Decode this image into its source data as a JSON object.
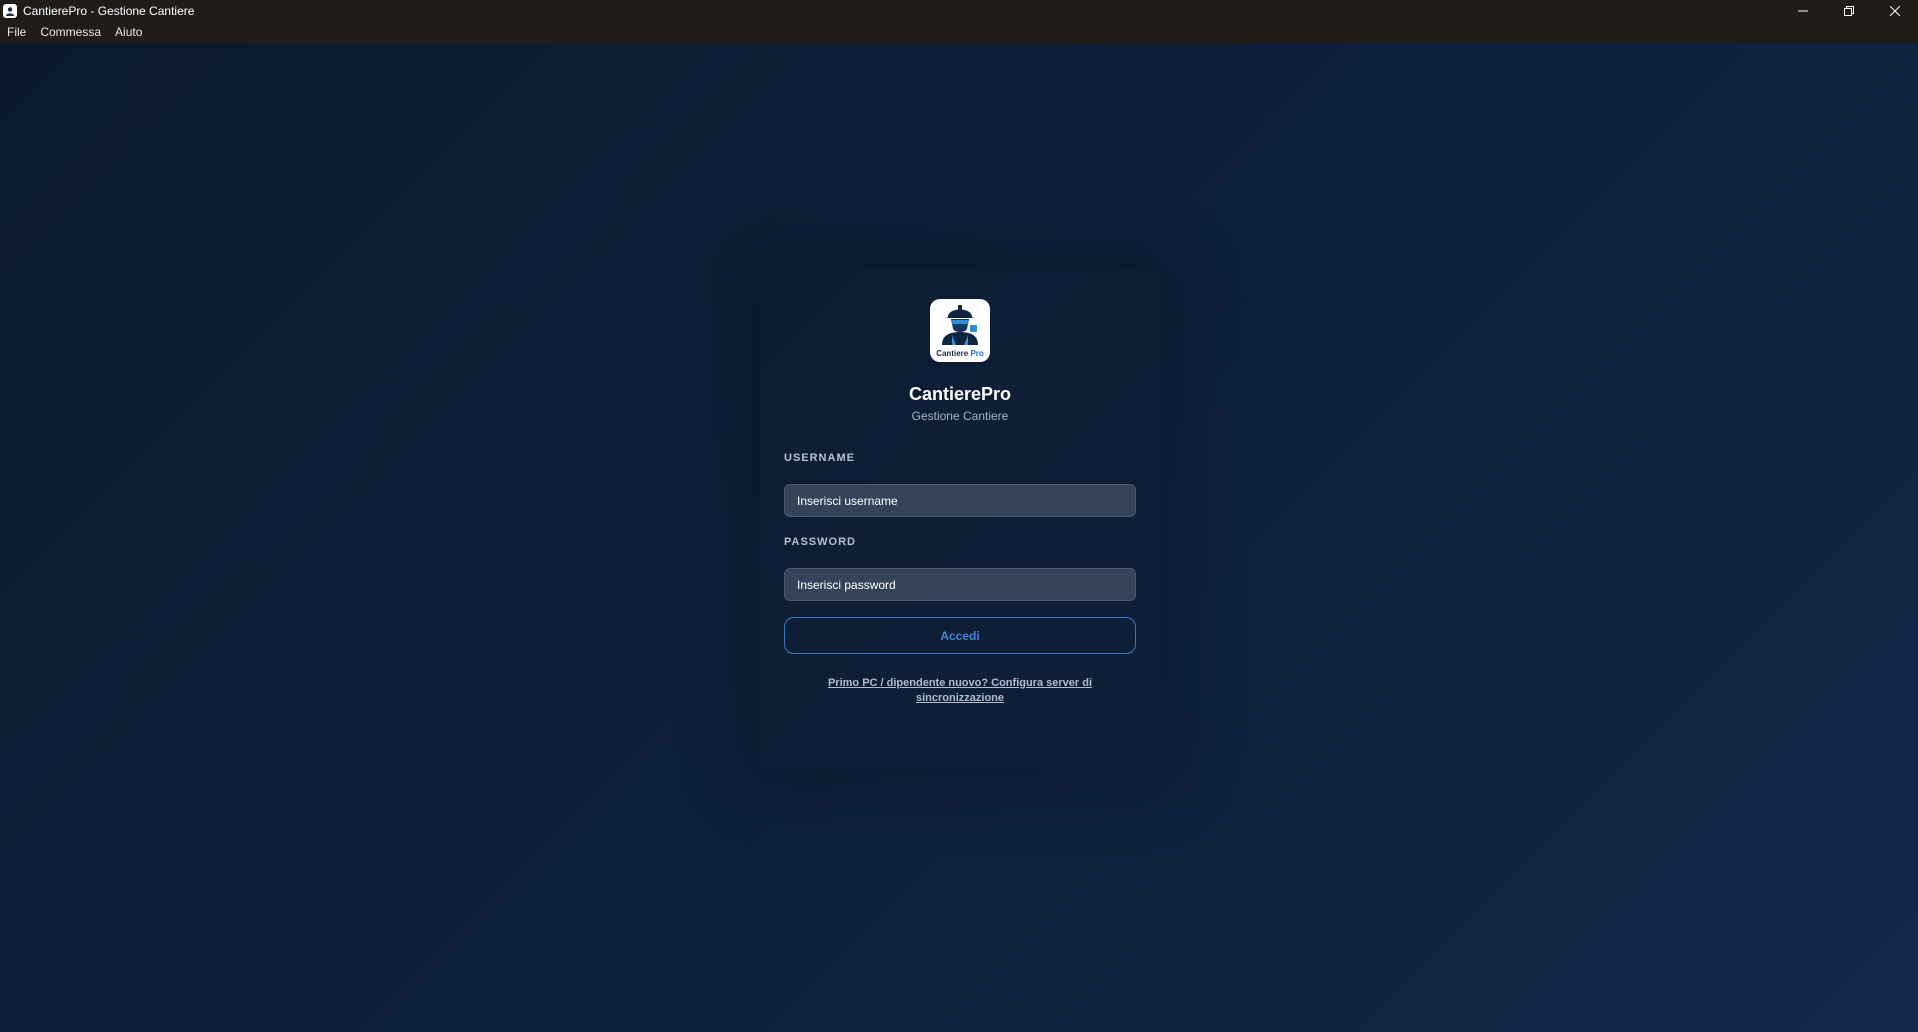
{
  "window": {
    "title": "CantierePro - Gestione Cantiere",
    "controls": [
      "minimize",
      "restore",
      "close"
    ]
  },
  "menu": {
    "items": [
      {
        "label": "File"
      },
      {
        "label": "Commessa"
      },
      {
        "label": "Aiuto"
      }
    ]
  },
  "login": {
    "logo_caption": "Cantiere",
    "logo_caption_accent": "Pro",
    "app_name": "CantierePro",
    "app_subtitle": "Gestione Cantiere",
    "username_label": "USERNAME",
    "username_placeholder": "Inserisci username",
    "password_label": "PASSWORD",
    "password_placeholder": "Inserisci password",
    "submit_label": "Accedi",
    "config_link": "Primo PC / dipendente nuovo? Configura server di sincronizzazione"
  },
  "colors": {
    "background": "#0e213a",
    "accent": "#3d86de",
    "input_bg": "#354358"
  }
}
